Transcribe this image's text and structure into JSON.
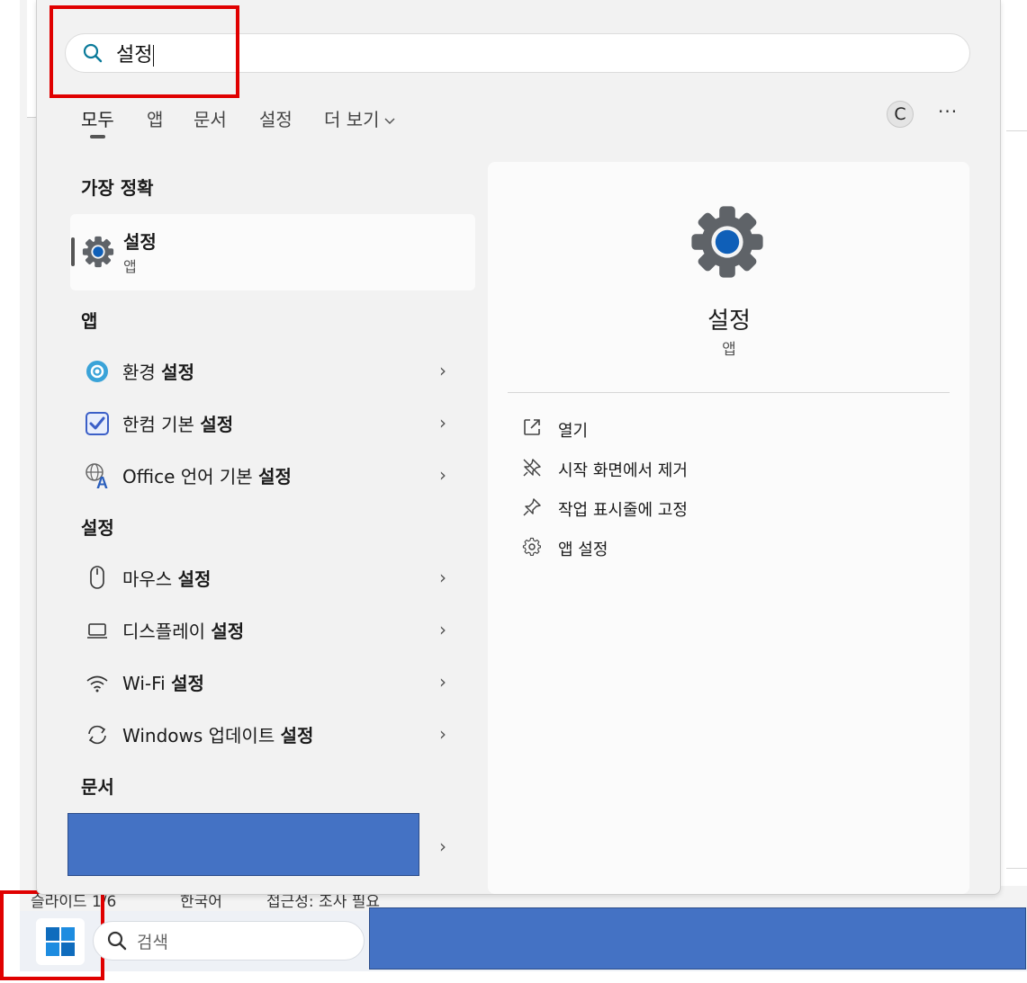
{
  "search": {
    "query": "설정"
  },
  "tabs": [
    {
      "label": "모두",
      "active": true
    },
    {
      "label": "앱"
    },
    {
      "label": "문서"
    },
    {
      "label": "설정"
    },
    {
      "label": "더 보기"
    }
  ],
  "account": {
    "initial": "C"
  },
  "more_label": "···",
  "sections": {
    "best_match": "가장 정확",
    "apps": "앱",
    "settings": "설정",
    "documents": "문서"
  },
  "best_match": {
    "title": "설정",
    "subtitle": "앱",
    "icon": "gear-icon"
  },
  "apps": [
    {
      "prefix": "환경 ",
      "bold": "설정",
      "icon": "control-panel-icon"
    },
    {
      "prefix": "한컴 기본 ",
      "bold": "설정",
      "icon": "hancom-check-icon"
    },
    {
      "prefix": "Office 언어 기본 ",
      "bold": "설정",
      "icon": "office-language-icon"
    }
  ],
  "settings": [
    {
      "prefix": "마우스 ",
      "bold": "설정",
      "icon": "mouse-icon"
    },
    {
      "prefix": "디스플레이 ",
      "bold": "설정",
      "icon": "display-icon"
    },
    {
      "prefix": "Wi-Fi ",
      "bold": "설정",
      "icon": "wifi-icon"
    },
    {
      "prefix": "Windows 업데이트 ",
      "bold": "설정",
      "icon": "update-icon"
    }
  ],
  "preview": {
    "title": "설정",
    "subtitle": "앱",
    "actions": [
      {
        "label": "열기",
        "icon": "open-external-icon"
      },
      {
        "label": "시작 화면에서 제거",
        "icon": "unpin-icon"
      },
      {
        "label": "작업 표시줄에 고정",
        "icon": "pin-icon"
      },
      {
        "label": "앱 설정",
        "icon": "gear-icon"
      }
    ]
  },
  "statusbar": {
    "slide": "슬라이드 1/6",
    "language": "한국어",
    "accessibility": "접근성: 조사 필요"
  },
  "taskbar": {
    "search_placeholder": "검색"
  },
  "colors": {
    "accent": "#0067c0",
    "redacted": "#4472c4",
    "highlight": "#e00000"
  }
}
